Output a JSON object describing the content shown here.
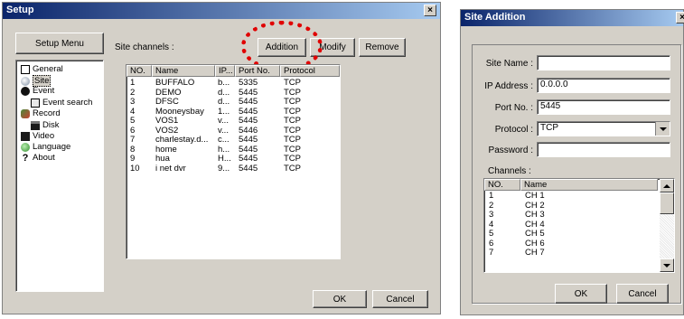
{
  "setup": {
    "title": "Setup",
    "close": "×",
    "menu_label": "Setup Menu",
    "tree": [
      {
        "label": "General",
        "icon": "general-icon"
      },
      {
        "label": "Site",
        "icon": "site-icon",
        "selected": true
      },
      {
        "label": "Event",
        "icon": "event-icon"
      },
      {
        "label": "Event search",
        "icon": "event-search-icon"
      },
      {
        "label": "Record",
        "icon": "record-icon"
      },
      {
        "label": "Disk",
        "icon": "disk-icon"
      },
      {
        "label": "Video",
        "icon": "video-icon"
      },
      {
        "label": "Language",
        "icon": "language-icon"
      },
      {
        "label": "About",
        "icon": "about-icon"
      }
    ],
    "site_channels_label": "Site channels :",
    "buttons": {
      "addition": "Addition",
      "modify": "Modify",
      "remove": "Remove",
      "ok": "OK",
      "cancel": "Cancel"
    },
    "columns": [
      "NO.",
      "Name",
      "IP...",
      "Port No.",
      "Protocol"
    ],
    "rows": [
      [
        "1",
        "BUFFALO",
        "b...",
        "5335",
        "TCP"
      ],
      [
        "2",
        "DEMO",
        "d...",
        "5445",
        "TCP"
      ],
      [
        "3",
        "DFSC",
        "d...",
        "5445",
        "TCP"
      ],
      [
        "4",
        "Mooneysbay",
        "1...",
        "5445",
        "TCP"
      ],
      [
        "5",
        "VOS1",
        "v...",
        "5445",
        "TCP"
      ],
      [
        "6",
        "VOS2",
        "v...",
        "5446",
        "TCP"
      ],
      [
        "7",
        "charlestay.d...",
        "c...",
        "5445",
        "TCP"
      ],
      [
        "8",
        "home",
        "h...",
        "5445",
        "TCP"
      ],
      [
        "9",
        "hua",
        "H...",
        "5445",
        "TCP"
      ],
      [
        "10",
        "i net dvr",
        "9...",
        "5445",
        "TCP"
      ]
    ]
  },
  "site_addition": {
    "title": "Site Addition",
    "close": "×",
    "site_name_label": "Site Name :",
    "site_name_value": "",
    "ip_label": "IP Address :",
    "ip_value": "0.0.0.0",
    "port_label": "Port No. :",
    "port_value": "5445",
    "protocol_label": "Protocol :",
    "protocol_value": "TCP",
    "password_label": "Password :",
    "password_value": "",
    "channels_label": "Channels :",
    "columns": [
      "NO.",
      "Name"
    ],
    "rows": [
      [
        "1",
        "CH 1"
      ],
      [
        "2",
        "CH 2"
      ],
      [
        "3",
        "CH 3"
      ],
      [
        "4",
        "CH 4"
      ],
      [
        "5",
        "CH 5"
      ],
      [
        "6",
        "CH 6"
      ],
      [
        "7",
        "CH 7"
      ]
    ],
    "buttons": {
      "ok": "OK",
      "cancel": "Cancel"
    }
  },
  "colors": {
    "highlight": "#e00000",
    "titlebar": "#0a246a"
  }
}
